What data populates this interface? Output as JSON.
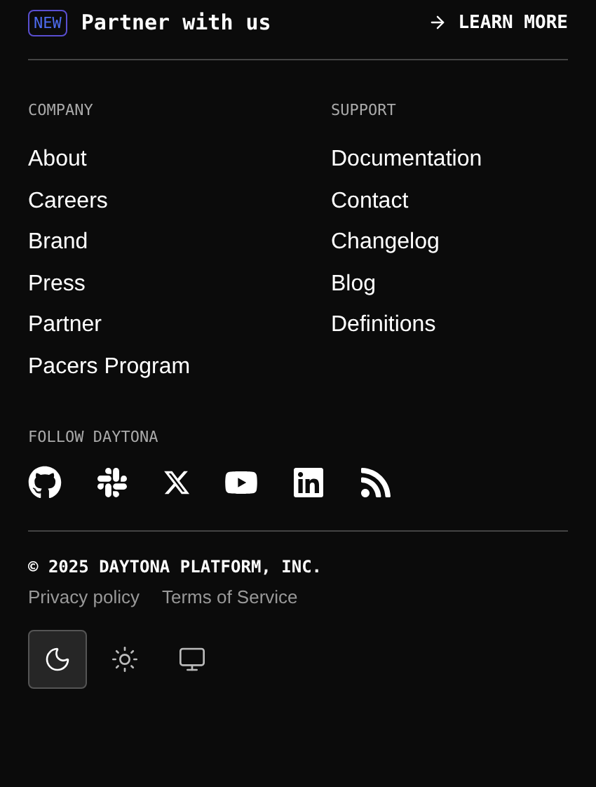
{
  "banner": {
    "badge": "NEW",
    "title": "Partner with us",
    "action": "LEARN MORE"
  },
  "columns": [
    {
      "heading": "COMPANY",
      "links": [
        "About",
        "Careers",
        "Brand",
        "Press",
        "Partner",
        "Pacers Program"
      ]
    },
    {
      "heading": "SUPPORT",
      "links": [
        "Documentation",
        "Contact",
        "Changelog",
        "Blog",
        "Definitions"
      ]
    }
  ],
  "follow": {
    "heading": "FOLLOW DAYTONA",
    "icons": [
      {
        "kind": "github"
      },
      {
        "kind": "slack"
      },
      {
        "kind": "x"
      },
      {
        "kind": "youtube"
      },
      {
        "kind": "linkedin"
      },
      {
        "kind": "rss"
      }
    ]
  },
  "copyright": "© 2025 DAYTONA PLATFORM, INC.",
  "legal_links": [
    "Privacy policy",
    "Terms of Service"
  ],
  "theme_buttons": [
    {
      "kind": "dark",
      "selected": true
    },
    {
      "kind": "light",
      "selected": false
    },
    {
      "kind": "system",
      "selected": false
    }
  ]
}
